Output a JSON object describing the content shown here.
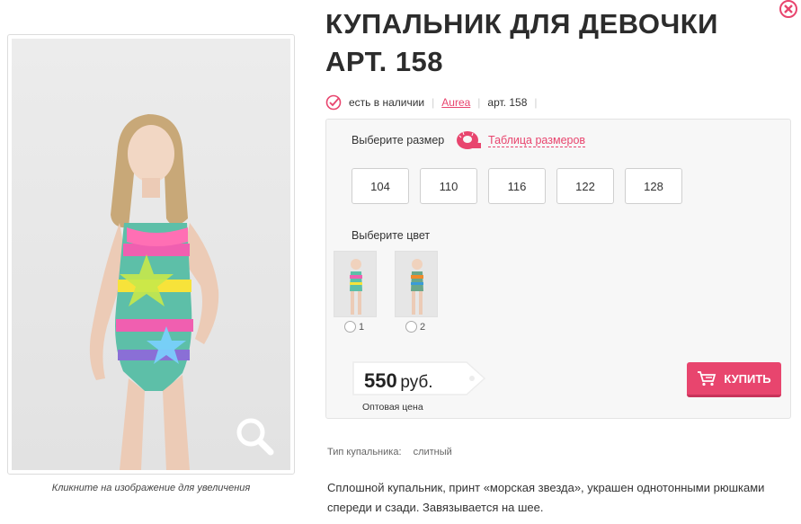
{
  "product": {
    "title": "КУПАЛЬНИК ДЛЯ ДЕВОЧКИ АРТ. 158",
    "availability": "есть в наличии",
    "brand": "Aurea",
    "article": "арт. 158"
  },
  "image": {
    "caption": "Кликните на изображение для увеличения"
  },
  "options": {
    "size_label": "Выберите размер",
    "size_table_link": "Таблица размеров",
    "sizes": [
      "104",
      "110",
      "116",
      "122",
      "128"
    ],
    "color_label": "Выберите цвет",
    "colors": [
      "1",
      "2"
    ]
  },
  "price": {
    "amount": "550",
    "currency": "руб.",
    "note": "Оптовая цена"
  },
  "buy_button": {
    "label": "КУПИТЬ"
  },
  "properties": {
    "type_label": "Тип купальника:",
    "type_value": "слитный"
  },
  "description": "Сплошной купальник, принт «морская звезда», украшен однотонными рюшками спереди и сзади. Завязывается на шее.",
  "colors_theme": {
    "accent": "#e8456e"
  }
}
